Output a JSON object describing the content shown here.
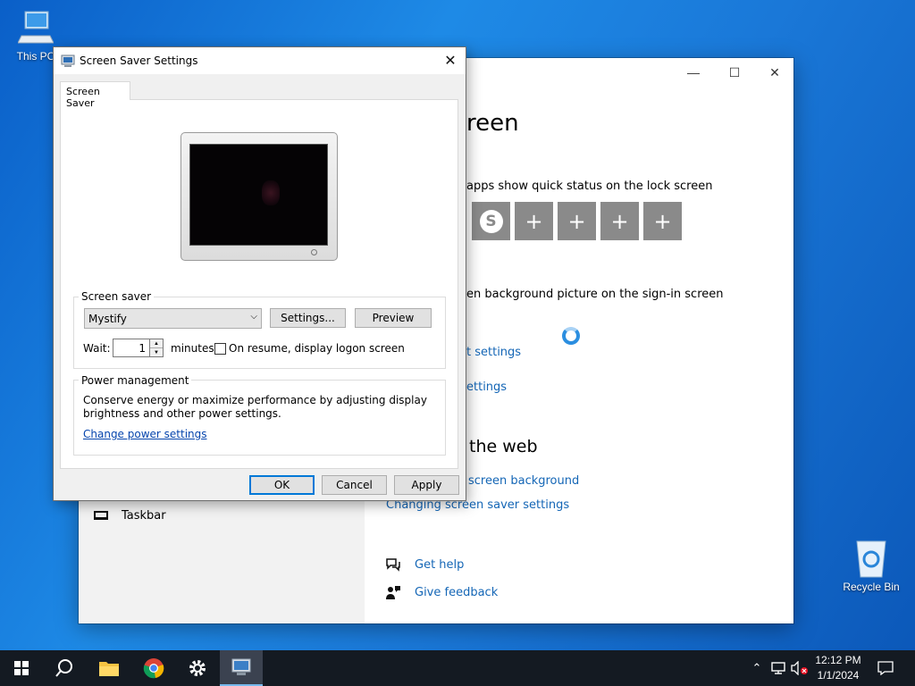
{
  "desktop": {
    "this_pc_label": "This PC",
    "recycle_bin_label": "Recycle Bin"
  },
  "settings": {
    "heading_fragment": "reen",
    "quick_status_text": "apps show quick status on the lock screen",
    "signin_text": "en background picture on the sign-in screen",
    "link_fragment_1": "t settings",
    "link_fragment_2": "ettings",
    "web_heading_fragment": "the web",
    "related_link_1_fragment": "screen background",
    "related_link_2": "Changing screen saver settings",
    "get_help": "Get help",
    "give_feedback": "Give feedback",
    "sidebar_taskbar": "Taskbar",
    "tile_plus": "+"
  },
  "dialog": {
    "title": "Screen Saver Settings",
    "tab_label": "Screen Saver",
    "screen_saver_group": "Screen saver",
    "screen_saver_selected": "Mystify",
    "settings_button": "Settings...",
    "preview_button": "Preview",
    "wait_label": "Wait:",
    "wait_value": "1",
    "minutes_label": "minutes",
    "logon_label": "On resume, display logon screen",
    "logon_checked": false,
    "power_group": "Power management",
    "power_text_1": "Conserve energy or maximize performance by adjusting display",
    "power_text_2": "brightness and other power settings.",
    "power_link": "Change power settings",
    "ok_button": "OK",
    "cancel_button": "Cancel",
    "apply_button": "Apply"
  },
  "taskbar": {
    "time": "12:12 PM",
    "date": "1/1/2024"
  },
  "colors": {
    "desktop": "#1a78d8",
    "accent": "#0078d7",
    "link": "#1466b6",
    "taskbar": "#141a22"
  }
}
